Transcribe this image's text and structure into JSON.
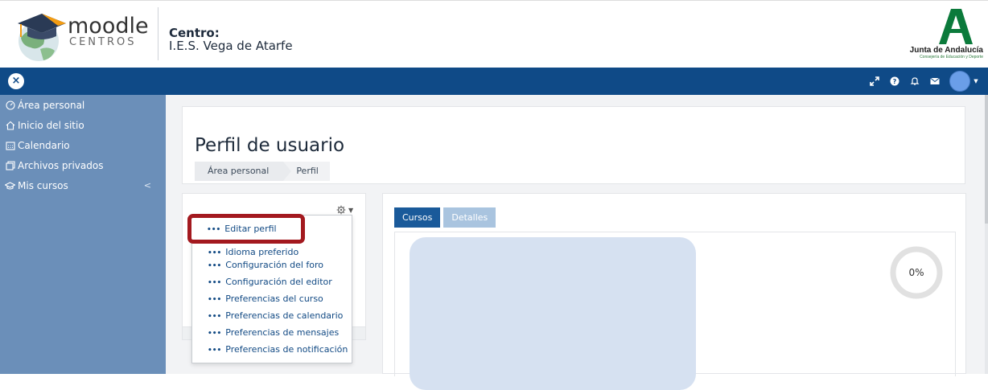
{
  "header": {
    "logo_main": "moodle",
    "logo_sub": "CENTROS",
    "centro_label": "Centro:",
    "centro_name": "I.E.S. Vega de Atarfe",
    "junta_title": "Junta de Andalucía",
    "junta_subtitle": "Consejería de Educación y Deporte"
  },
  "navbar": {
    "close_symbol": "×",
    "icons": [
      "expand-icon",
      "help-icon",
      "bell-icon",
      "envelope-icon"
    ]
  },
  "sidebar": {
    "items": [
      {
        "label": "Área personal",
        "icon": "dashboard-icon"
      },
      {
        "label": "Inicio del sitio",
        "icon": "home-icon"
      },
      {
        "label": "Calendario",
        "icon": "calendar-icon"
      },
      {
        "label": "Archivos privados",
        "icon": "files-icon"
      },
      {
        "label": "Mis cursos",
        "icon": "graduation-cap-icon",
        "collapse": "<"
      }
    ]
  },
  "page": {
    "title": "Perfil de usuario",
    "breadcrumb": [
      "Área personal",
      "Perfil"
    ]
  },
  "profile_menu": {
    "highlighted": "Editar perfil",
    "partially_hidden": "Idioma preferido",
    "items": [
      "Configuración del foro",
      "Configuración del editor",
      "Preferencias del curso",
      "Preferencias de calendario",
      "Preferencias de mensajes",
      "Preferencias de notificación"
    ]
  },
  "tabs": {
    "active": "Cursos",
    "inactive": "Detalles"
  },
  "course": {
    "progress_text": "0%",
    "progress_value": 0
  },
  "colors": {
    "navbar": "#0f4a87",
    "sidebar": "#6b8fb9",
    "highlight_border": "#a3191f",
    "link": "#124a84"
  }
}
